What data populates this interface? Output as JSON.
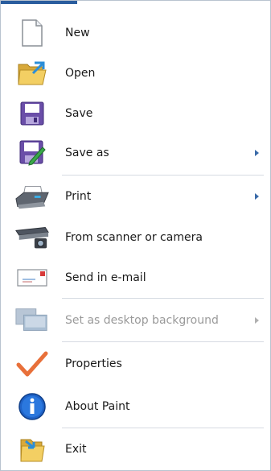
{
  "menu": {
    "items": [
      {
        "label": "New",
        "icon": "new-document-icon",
        "submenu": false,
        "disabled": false
      },
      {
        "label": "Open",
        "icon": "open-folder-icon",
        "submenu": false,
        "disabled": false
      },
      {
        "label": "Save",
        "icon": "floppy-disk-icon",
        "submenu": false,
        "disabled": false
      },
      {
        "label": "Save as",
        "icon": "save-as-icon",
        "submenu": true,
        "disabled": false
      },
      {
        "label": "Print",
        "icon": "printer-icon",
        "submenu": true,
        "disabled": false
      },
      {
        "label": "From scanner or camera",
        "icon": "scanner-icon",
        "submenu": false,
        "disabled": false
      },
      {
        "label": "Send in e-mail",
        "icon": "email-icon",
        "submenu": false,
        "disabled": false
      },
      {
        "label": "Set as desktop background",
        "icon": "desktop-background-icon",
        "submenu": true,
        "disabled": true
      },
      {
        "label": "Properties",
        "icon": "checkmark-icon",
        "submenu": false,
        "disabled": false
      },
      {
        "label": "About Paint",
        "icon": "info-icon",
        "submenu": false,
        "disabled": false
      },
      {
        "label": "Exit",
        "icon": "exit-icon",
        "submenu": false,
        "disabled": false
      }
    ]
  },
  "colors": {
    "accent": "#2a5d9e",
    "submenu_arrow": "#3a6aa8",
    "disabled_text": "#9a9a9a",
    "checkmark": "#e8703a",
    "info": "#1f63c8"
  }
}
